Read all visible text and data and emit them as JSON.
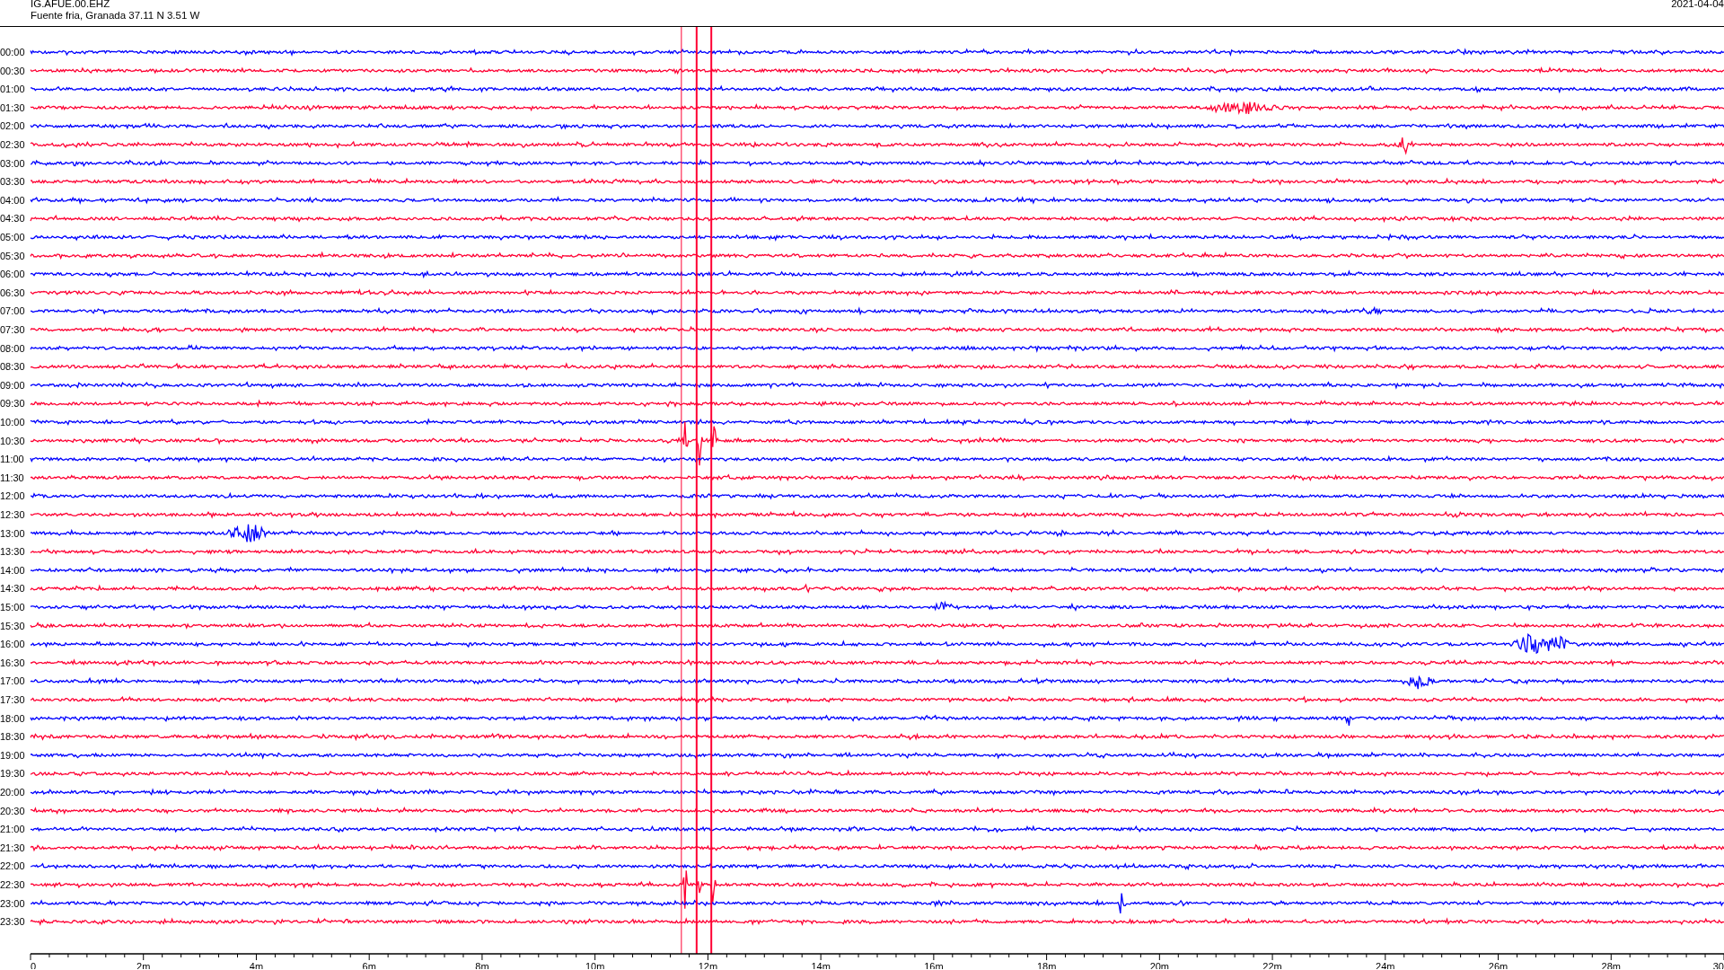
{
  "header": {
    "station_code": "IG.AFUE.00.EHZ",
    "location": "Fuente fria, Granada  37.11 N 3.51 W",
    "date": "2021-04-04"
  },
  "rows": [
    {
      "label": "00:00",
      "color": "#0000ff"
    },
    {
      "label": "00:30",
      "color": "#ff0033"
    },
    {
      "label": "01:00",
      "color": "#0000ff"
    },
    {
      "label": "01:30",
      "color": "#ff0033"
    },
    {
      "label": "02:00",
      "color": "#0000ff"
    },
    {
      "label": "02:30",
      "color": "#ff0033"
    },
    {
      "label": "03:00",
      "color": "#0000ff"
    },
    {
      "label": "03:30",
      "color": "#ff0033"
    },
    {
      "label": "04:00",
      "color": "#0000ff"
    },
    {
      "label": "04:30",
      "color": "#ff0033"
    },
    {
      "label": "05:00",
      "color": "#0000ff"
    },
    {
      "label": "05:30",
      "color": "#ff0033"
    },
    {
      "label": "06:00",
      "color": "#0000ff"
    },
    {
      "label": "06:30",
      "color": "#ff0033"
    },
    {
      "label": "07:00",
      "color": "#0000ff"
    },
    {
      "label": "07:30",
      "color": "#ff0033"
    },
    {
      "label": "08:00",
      "color": "#0000ff"
    },
    {
      "label": "08:30",
      "color": "#ff0033"
    },
    {
      "label": "09:00",
      "color": "#0000ff"
    },
    {
      "label": "09:30",
      "color": "#ff0033"
    },
    {
      "label": "10:00",
      "color": "#0000ff"
    },
    {
      "label": "10:30",
      "color": "#ff0033"
    },
    {
      "label": "11:00",
      "color": "#0000ff"
    },
    {
      "label": "11:30",
      "color": "#ff0033"
    },
    {
      "label": "12:00",
      "color": "#0000ff"
    },
    {
      "label": "12:30",
      "color": "#ff0033"
    },
    {
      "label": "13:00",
      "color": "#0000ff"
    },
    {
      "label": "13:30",
      "color": "#ff0033"
    },
    {
      "label": "14:00",
      "color": "#0000ff"
    },
    {
      "label": "14:30",
      "color": "#ff0033"
    },
    {
      "label": "15:00",
      "color": "#0000ff"
    },
    {
      "label": "15:30",
      "color": "#ff0033"
    },
    {
      "label": "16:00",
      "color": "#0000ff"
    },
    {
      "label": "16:30",
      "color": "#ff0033"
    },
    {
      "label": "17:00",
      "color": "#0000ff"
    },
    {
      "label": "17:30",
      "color": "#ff0033"
    },
    {
      "label": "18:00",
      "color": "#0000ff"
    },
    {
      "label": "18:30",
      "color": "#ff0033"
    },
    {
      "label": "19:00",
      "color": "#0000ff"
    },
    {
      "label": "19:30",
      "color": "#ff0033"
    },
    {
      "label": "20:00",
      "color": "#0000ff"
    },
    {
      "label": "20:30",
      "color": "#ff0033"
    },
    {
      "label": "21:00",
      "color": "#0000ff"
    },
    {
      "label": "21:30",
      "color": "#ff0033"
    },
    {
      "label": "22:00",
      "color": "#0000ff"
    },
    {
      "label": "22:30",
      "color": "#ff0033"
    },
    {
      "label": "23:00",
      "color": "#0000ff"
    },
    {
      "label": "23:30",
      "color": "#ff0033"
    }
  ],
  "x_axis": {
    "tick_labels": [
      "0",
      "2m",
      "4m",
      "6m",
      "8m",
      "10m",
      "12m",
      "14m",
      "16m",
      "18m",
      "20m",
      "22m",
      "24m",
      "26m",
      "28m",
      "30"
    ]
  }
}
